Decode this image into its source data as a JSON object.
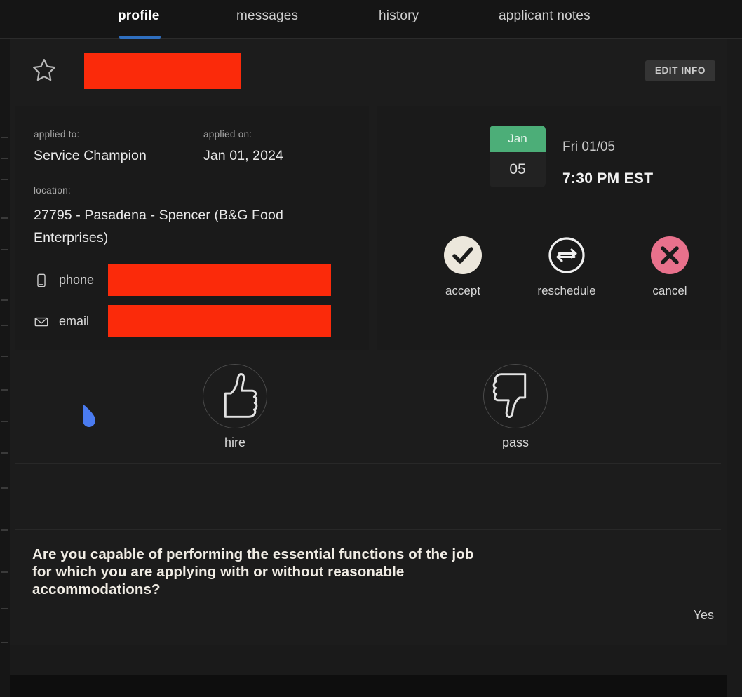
{
  "tabs": [
    {
      "label": "profile",
      "active": true
    },
    {
      "label": "messages",
      "active": false
    },
    {
      "label": "history",
      "active": false
    },
    {
      "label": "applicant notes",
      "active": false
    }
  ],
  "header": {
    "favorite_icon": "star-icon",
    "candidate_name_redacted": "",
    "edit_info_label": "EDIT INFO"
  },
  "info_card": {
    "applied_to_label": "applied to:",
    "applied_to_value": "Service Champion",
    "applied_on_label": "applied on:",
    "applied_on_value": "Jan 01, 2024",
    "location_label": "location:",
    "location_value": "27795 - Pasadena - Spencer (B&G Food Enterprises)",
    "phone_label": "phone",
    "phone_value_redacted": "",
    "email_label": "email",
    "email_value_redacted": ""
  },
  "interview_card": {
    "month": "Jan",
    "day": "05",
    "date_text": "Fri 01/05",
    "time_text": "7:30 PM EST",
    "actions": [
      {
        "label": "accept",
        "icon": "check-icon"
      },
      {
        "label": "reschedule",
        "icon": "swap-arrows-icon"
      },
      {
        "label": "cancel",
        "icon": "close-x-icon"
      }
    ]
  },
  "decision": {
    "hire_label": "hire",
    "hire_icon": "thumbs-up-icon",
    "pass_label": "pass",
    "pass_icon": "thumbs-down-icon"
  },
  "question": {
    "text": "Are you capable of performing the essential functions of the job for which you are applying with or without reasonable accommodations?",
    "answer": "Yes"
  },
  "colors": {
    "accent_blue": "#2f6fc0",
    "redaction_red": "#fb2a0a",
    "month_green": "#4cae78",
    "accept_cream": "#ece7dc",
    "cancel_pink": "#e8718c",
    "cursor_blue": "#4a7bf0",
    "panel_bg": "#1c1c1c",
    "card_bg": "#1a1a1a"
  }
}
